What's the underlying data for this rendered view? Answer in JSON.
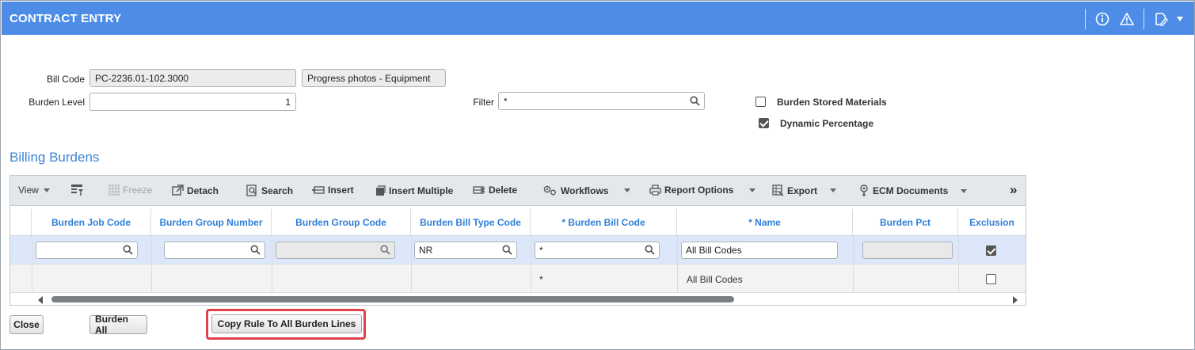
{
  "header": {
    "title": "CONTRACT ENTRY"
  },
  "form": {
    "bill_code_label": "Bill Code",
    "bill_code_value": "PC-2236.01-102.3000",
    "bill_code_desc": "Progress photos - Equipment",
    "burden_level_label": "Burden Level",
    "burden_level_value": "1",
    "filter_label": "Filter",
    "filter_value": "*",
    "burden_stored_materials_label": "Burden Stored Materials",
    "burden_stored_materials_checked": false,
    "dynamic_percentage_label": "Dynamic Percentage",
    "dynamic_percentage_checked": true
  },
  "section": {
    "title": "Billing Burdens"
  },
  "toolbar": {
    "view": "View",
    "freeze": "Freeze",
    "detach": "Detach",
    "search": "Search",
    "insert": "Insert",
    "insert_multiple": "Insert Multiple",
    "delete": "Delete",
    "workflows": "Workflows",
    "report_options": "Report Options",
    "export": "Export",
    "ecm_documents": "ECM Documents",
    "more": "»"
  },
  "grid": {
    "columns": [
      "Burden Job Code",
      "Burden Group Number",
      "Burden Group Code",
      "Burden Bill Type Code",
      "* Burden Bill Code",
      "* Name",
      "Burden Pct",
      "Exclusion"
    ],
    "edit_row": {
      "burden_bill_type_code": "NR",
      "burden_bill_code": "*",
      "name": "All Bill Codes",
      "exclusion": true
    },
    "rows": [
      {
        "burden_bill_code": "*",
        "name": "All Bill Codes",
        "exclusion": false
      }
    ]
  },
  "buttons": {
    "close": "Close",
    "burden_all": "Burden All",
    "copy_rule": "Copy Rule To All Burden Lines"
  },
  "colors": {
    "header_bg": "#4d8de8",
    "accent": "#2f7fd6",
    "highlight": "#e0414a",
    "selected_row": "#dce8fa"
  }
}
